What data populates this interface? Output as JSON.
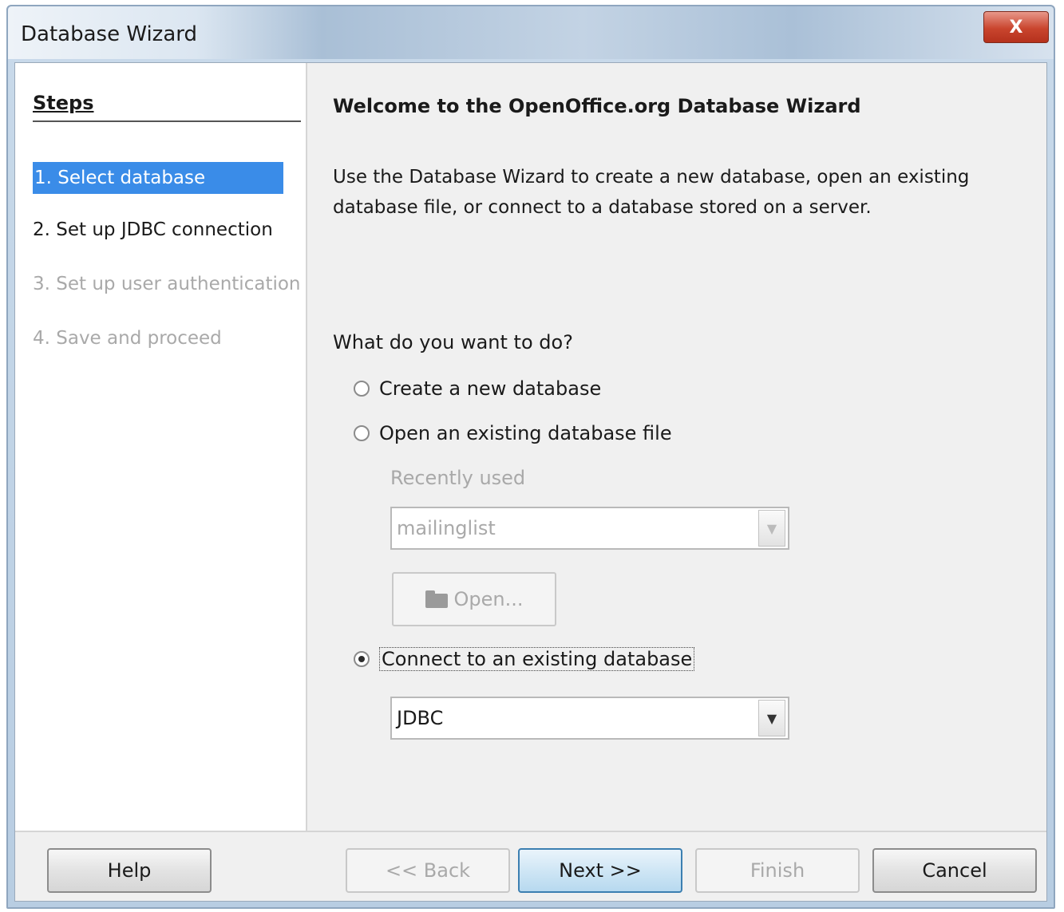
{
  "window": {
    "title": "Database Wizard",
    "close_label": "X"
  },
  "steps": {
    "title": "Steps",
    "items": [
      {
        "label": "1. Select database",
        "state": "selected"
      },
      {
        "label": "2. Set up JDBC connection",
        "state": "enabled"
      },
      {
        "label": "3. Set up user authentication",
        "state": "disabled"
      },
      {
        "label": "4. Save and proceed",
        "state": "disabled"
      }
    ]
  },
  "main": {
    "heading": "Welcome to the OpenOffice.org Database Wizard",
    "description": "Use the Database Wizard to create a new database, open an existing database file, or connect to a database stored on a server.",
    "question": "What do you want to do?",
    "options": {
      "create_new": "Create a new database",
      "open_existing": "Open an existing database file",
      "connect_existing": "Connect to an existing database"
    },
    "selected_option": "connect_existing",
    "recently_used_label": "Recently used",
    "recently_used_value": "mailinglist",
    "open_button": "Open...",
    "connection_type_value": "JDBC"
  },
  "buttons": {
    "help": "Help",
    "back": "<< Back",
    "next": "Next >>",
    "finish": "Finish",
    "cancel": "Cancel"
  },
  "icons": {
    "close": "close-icon",
    "folder": "folder-icon",
    "dropdown": "chevron-down-icon"
  },
  "colors": {
    "selection": "#3a8ce8",
    "disabled_text": "#a9a9a9",
    "close_button": "#c9452e"
  }
}
